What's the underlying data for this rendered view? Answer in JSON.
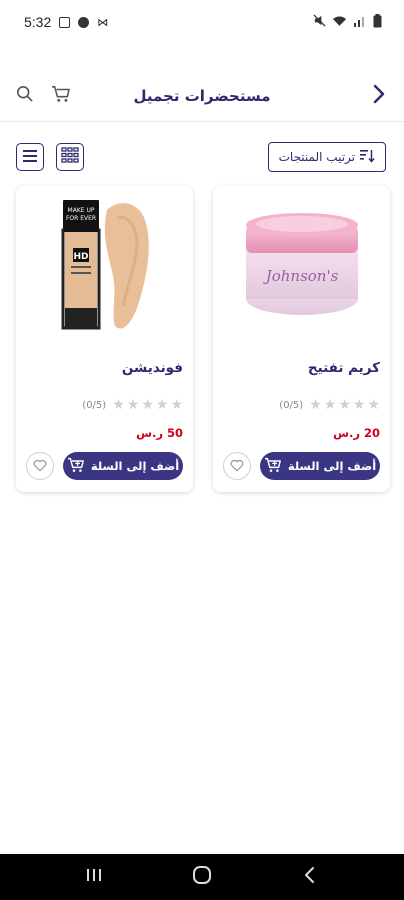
{
  "status_bar": {
    "time": "5:32"
  },
  "header": {
    "title": "مستحضرات تجميل"
  },
  "toolbar": {
    "sort_label": "ترتيب المنتجات"
  },
  "products": [
    {
      "name": "كريم تفتيح",
      "rating_text": "(0/5)",
      "rating": 0,
      "max_rating": 5,
      "price": "20 ر.س",
      "add_to_cart_label": "أضف إلى السلة",
      "image_brand": "Johnson's"
    },
    {
      "name": "فونديشن",
      "rating_text": "(0/5)",
      "rating": 0,
      "max_rating": 5,
      "price": "50 ر.س",
      "add_to_cart_label": "أضف إلى السلة",
      "image_brand_lines": [
        "MAKE UP",
        "FOR EVER",
        "HD"
      ]
    }
  ],
  "colors": {
    "primary": "#3b3684",
    "price": "#d0021b",
    "star_empty": "#cfcfd6"
  },
  "icons": {
    "back": "chevron-right-icon",
    "cart": "cart-icon",
    "search": "search-icon",
    "sort": "sort-icon",
    "grid_view": "grid-view-icon",
    "list_view": "list-view-icon",
    "add_cart": "add-cart-icon",
    "favorite": "heart-icon"
  }
}
